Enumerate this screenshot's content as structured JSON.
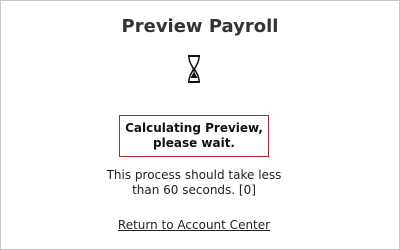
{
  "page": {
    "title": "Preview Payroll"
  },
  "icons": {
    "loading": "hourglass-icon"
  },
  "status": {
    "line1": "Calculating Preview,",
    "line2": "please wait."
  },
  "info": {
    "line1": "This process should take less",
    "line2": "than 60 seconds. [0]"
  },
  "links": {
    "return": "Return to Account Center"
  },
  "colors": {
    "status_border": "#b3262e"
  }
}
